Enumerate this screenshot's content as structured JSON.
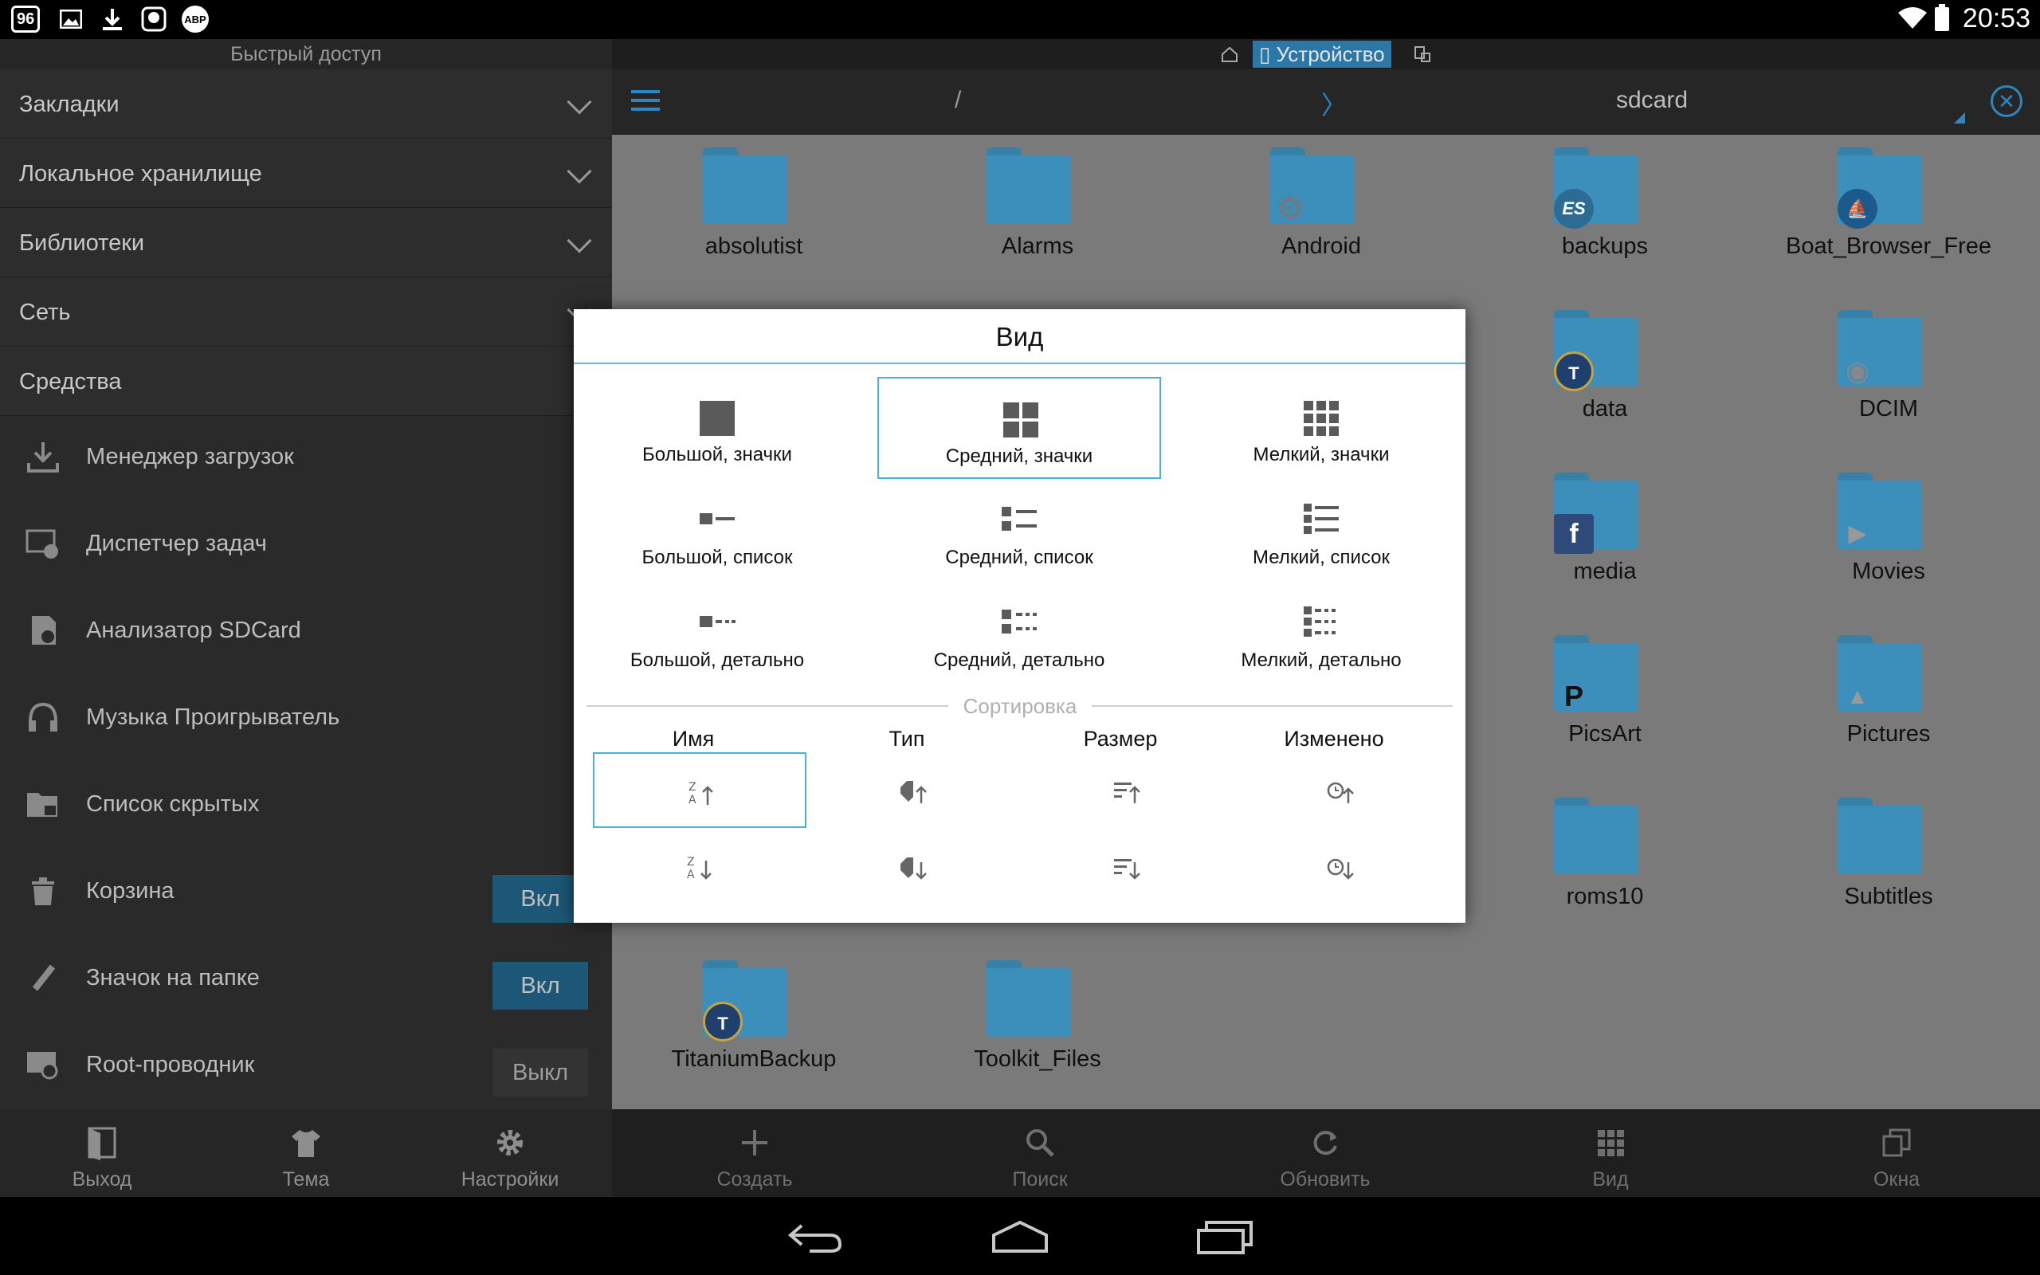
{
  "status_bar": {
    "time": "20:53",
    "left_icons": [
      "badge-96",
      "image-icon",
      "download-icon",
      "ghost-icon",
      "abp-icon"
    ],
    "badge_text": "96",
    "abp_text": "ABP"
  },
  "left_panel": {
    "title": "Быстрый доступ",
    "sections": [
      {
        "label": "Закладки"
      },
      {
        "label": "Локальное хранилище"
      },
      {
        "label": "Библиотеки"
      },
      {
        "label": "Сеть"
      },
      {
        "label": "Средства"
      }
    ],
    "tools": [
      {
        "label": "Менеджер загрузок",
        "icon": "download-icon"
      },
      {
        "label": "Диспетчер задач",
        "icon": "task-manager-icon"
      },
      {
        "label": "Анализатор SDCard",
        "icon": "sdcard-icon"
      },
      {
        "label": "Музыка Проигрыватель",
        "icon": "headphones-icon"
      },
      {
        "label": "Список скрытых",
        "icon": "hidden-folder-icon"
      },
      {
        "label": "Корзина",
        "icon": "trash-icon",
        "toggle": "Вкл"
      },
      {
        "label": "Значок на папке",
        "icon": "link-icon",
        "toggle": "Вкл"
      },
      {
        "label": "Root-проводник",
        "icon": "root-icon",
        "toggle": "Выкл"
      }
    ],
    "bottom": [
      {
        "label": "Выход",
        "icon": "exit-icon"
      },
      {
        "label": "Тема",
        "icon": "tshirt-icon"
      },
      {
        "label": "Настройки",
        "icon": "gear-icon"
      }
    ]
  },
  "right_panel": {
    "device_tab": "Устройство",
    "path_root": "/",
    "path_sep": "〉",
    "path_current": "sdcard",
    "close_symbol": "✕",
    "folders": [
      {
        "name": "absolutist"
      },
      {
        "name": "Alarms"
      },
      {
        "name": "Android",
        "overlay": "⚙"
      },
      {
        "name": "backups",
        "overlay": "ES"
      },
      {
        "name": "Boat_Browser_Free",
        "overlay": "⛵"
      },
      {
        "name": "data",
        "overlay": "T"
      },
      {
        "name": "DCIM",
        "overlay": "◉"
      },
      {
        "name": "media",
        "overlay": "f"
      },
      {
        "name": "Movies",
        "overlay": "▶"
      },
      {
        "name": "PicsArt",
        "overlay": "P"
      },
      {
        "name": "Pictures",
        "overlay": "▲"
      },
      {
        "name": "roms10"
      },
      {
        "name": "Subtitles"
      },
      {
        "name": "TitaniumBackup",
        "overlay": "T"
      },
      {
        "name": "Toolkit_Files"
      }
    ],
    "bottom": [
      {
        "label": "Создать",
        "icon": "plus-icon"
      },
      {
        "label": "Поиск",
        "icon": "search-icon"
      },
      {
        "label": "Обновить",
        "icon": "refresh-icon"
      },
      {
        "label": "Вид",
        "icon": "grid-icon"
      },
      {
        "label": "Окна",
        "icon": "windows-icon"
      }
    ]
  },
  "dialog": {
    "title": "Вид",
    "view_options": [
      {
        "label": "Большой, значки",
        "icon": "large-icons-icon"
      },
      {
        "label": "Средний, значки",
        "icon": "medium-icons-icon",
        "selected": true
      },
      {
        "label": "Мелкий, значки",
        "icon": "small-icons-icon"
      },
      {
        "label": "Большой, список",
        "icon": "large-list-icon"
      },
      {
        "label": "Средний, список",
        "icon": "medium-list-icon"
      },
      {
        "label": "Мелкий, список",
        "icon": "small-list-icon"
      },
      {
        "label": "Большой, детально",
        "icon": "large-detail-icon"
      },
      {
        "label": "Средний, детально",
        "icon": "medium-detail-icon"
      },
      {
        "label": "Мелкий, детально",
        "icon": "small-detail-icon"
      }
    ],
    "sort_title": "Сортировка",
    "sort_columns": [
      {
        "label": "Имя",
        "icon": "sort-name-icon"
      },
      {
        "label": "Тип",
        "icon": "sort-type-icon"
      },
      {
        "label": "Размер",
        "icon": "sort-size-icon"
      },
      {
        "label": "Изменено",
        "icon": "sort-modified-icon"
      }
    ],
    "selected_sort": "Имя по возрастанию",
    "az_text": "Z\nA"
  },
  "colors": {
    "accent": "#2b86c2",
    "folder": "#3d8fbb",
    "toggle_on": "#1c5778",
    "dialog_selection": "#4ab0e0"
  }
}
